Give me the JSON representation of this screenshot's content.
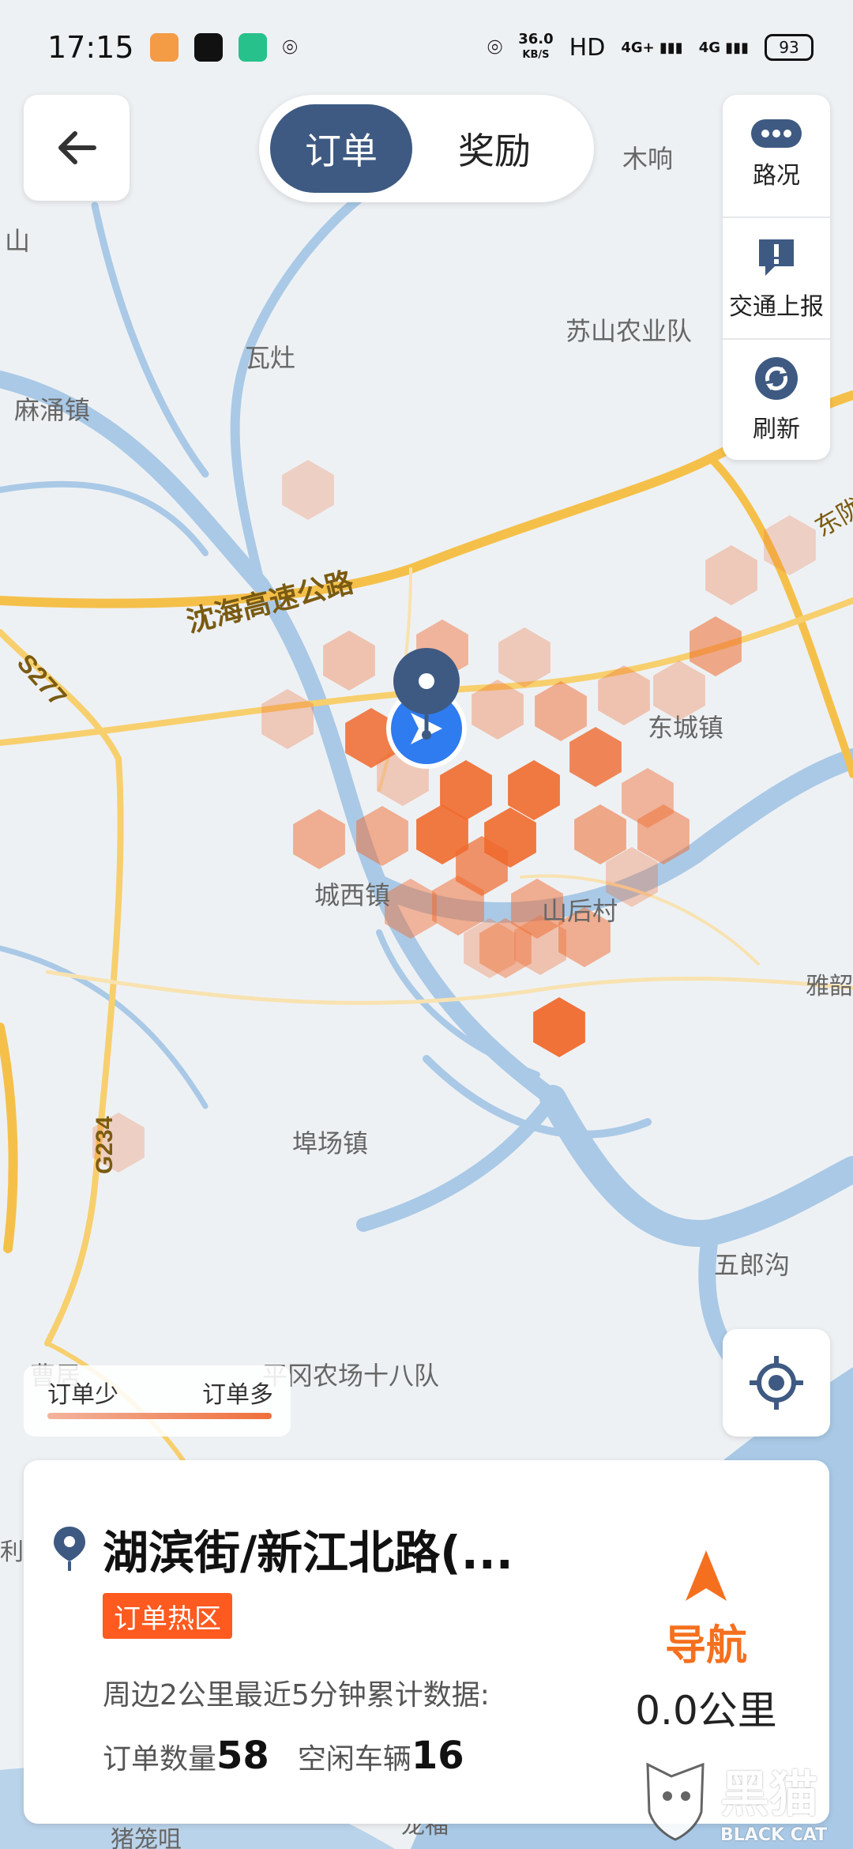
{
  "status_bar": {
    "time": "17:15",
    "net_speed_value": "36.0",
    "net_speed_unit": "KB/S",
    "hd": "HD",
    "signal_1": "4G+",
    "signal_2": "4G",
    "battery": "93"
  },
  "toggle": {
    "active": "订单",
    "inactive": "奖励"
  },
  "right_panel": [
    {
      "label": "路况",
      "icon": "more-dots-icon"
    },
    {
      "label": "交通上报",
      "icon": "alert-icon"
    },
    {
      "label": "刷新",
      "icon": "refresh-icon"
    }
  ],
  "legend": {
    "low": "订单少",
    "high": "订单多"
  },
  "map_labels": [
    {
      "text": "木响"
    },
    {
      "text": "瓦灶"
    },
    {
      "text": "麻涌镇"
    },
    {
      "text": "苏山农业队"
    },
    {
      "text": "沈海高速公路"
    },
    {
      "text": "S277"
    },
    {
      "text": "东城镇"
    },
    {
      "text": "城西镇"
    },
    {
      "text": "山后村"
    },
    {
      "text": "雅韶"
    },
    {
      "text": "埠场镇"
    },
    {
      "text": "G234"
    },
    {
      "text": "五郎沟"
    },
    {
      "text": "平冈农场十八队"
    },
    {
      "text": "曹居"
    },
    {
      "text": "东陇"
    },
    {
      "text": "山"
    },
    {
      "text": "利"
    },
    {
      "text": "猪笼咀"
    },
    {
      "text": "龙福"
    }
  ],
  "bottom_card": {
    "place_name": "湖滨街/新江北路(...",
    "tag": "订单热区",
    "description": "周边2公里最近5分钟累计数据:",
    "order_count_label": "订单数量",
    "order_count": "58",
    "idle_vehicles_label": "空闲车辆",
    "idle_vehicles": "16",
    "nav_label": "导航",
    "nav_distance": "0.0公里"
  },
  "watermark": {
    "text": "黑猫",
    "sub": "BLACK CAT"
  },
  "colors": {
    "accent_dark": "#3e5a82",
    "hot_orange": "#ff5a1f",
    "nav_orange": "#f5701e",
    "road_yellow": "#f5c04a",
    "water_blue": "#a9c9e6"
  }
}
